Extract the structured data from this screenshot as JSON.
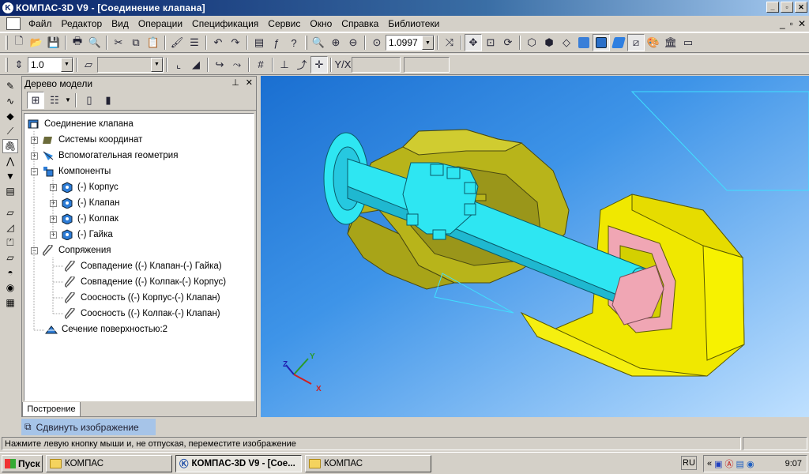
{
  "window": {
    "title": "КОМПАС-3D V9 - [Соединение клапана]"
  },
  "menu": {
    "items": [
      "Файл",
      "Редактор",
      "Вид",
      "Операции",
      "Спецификация",
      "Сервис",
      "Окно",
      "Справка",
      "Библиотеки"
    ]
  },
  "toolbar": {
    "zoom_value": "1.0997",
    "step_value": "1.0"
  },
  "tree": {
    "title": "Дерево модели",
    "root": "Соединение клапана",
    "nodes": [
      "Системы координат",
      "Вспомогательная геометрия",
      "Компоненты",
      "(-) Корпус",
      "(-) Клапан",
      "(-) Колпак",
      "(-) Гайка",
      "Сопряжения",
      "Совпадение ((-) Клапан-(-) Гайка)",
      "Совпадение ((-) Колпак-(-) Корпус)",
      "Соосность ((-) Корпус-(-) Клапан)",
      "Соосность ((-) Колпак-(-) Клапан)",
      "Сечение поверхностью:2"
    ],
    "tab": "Построение"
  },
  "hint": "Сдвинуть изображение",
  "status": "Нажмите левую кнопку мыши и, не отпуская, переместите изображение",
  "axes": {
    "x": "X",
    "y": "Y",
    "z": "Z"
  },
  "taskbar": {
    "start": "Пуск",
    "tasks": [
      "КОМПАС",
      "КОМПАС-3D V9 - [Сое...",
      "КОМПАС"
    ],
    "lang": "RU",
    "clock": "9:07"
  },
  "colors": {
    "part_yellow": "#f0e800",
    "part_olive": "#b8b41a",
    "shaft_cyan": "#2ee6f2",
    "nut_pink": "#f0a6b4",
    "viewport_blue": "#1a6fd1"
  }
}
